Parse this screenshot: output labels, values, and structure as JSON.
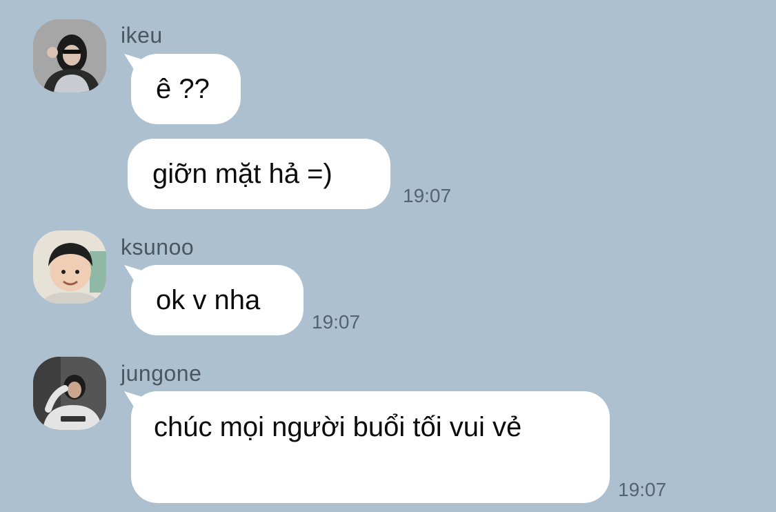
{
  "messages": [
    {
      "sender": "ikeu",
      "bubbles": [
        "ê ??",
        "giỡn mặt hả =)"
      ],
      "time": "19:07"
    },
    {
      "sender": "ksunoo",
      "bubbles": [
        "ok v nha"
      ],
      "time": "19:07"
    },
    {
      "sender": "jungone",
      "bubbles": [
        "chúc mọi người buổi tối vui vẻ"
      ],
      "time": "19:07"
    }
  ],
  "colors": {
    "background": "#adc0d0",
    "bubble": "#ffffff",
    "sender_text": "#4a5661",
    "time_text": "#556270"
  }
}
